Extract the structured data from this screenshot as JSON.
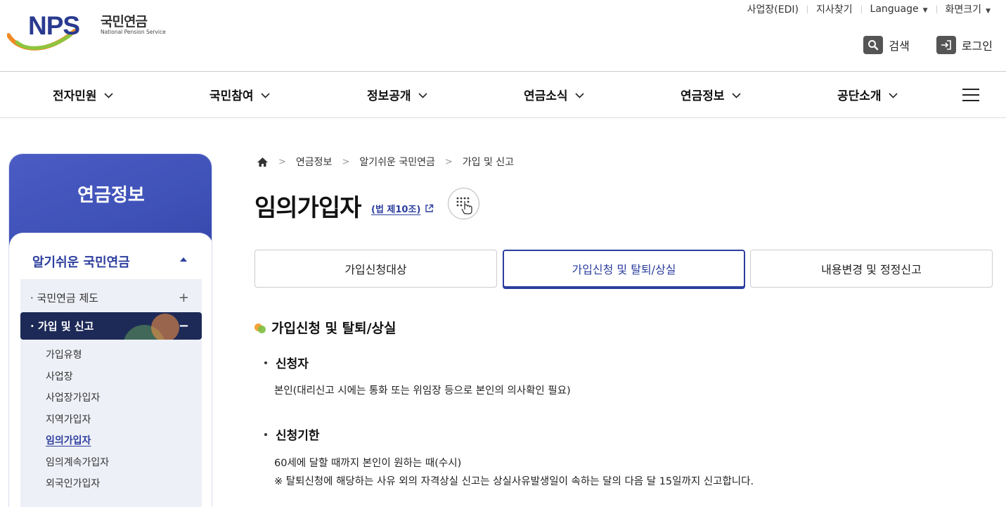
{
  "header": {
    "logo_mark": "NPS",
    "logo_name_ko": "국민연금",
    "logo_name_en": "National Pension Service",
    "util": {
      "edi": "사업장(EDI)",
      "branch": "지사찾기",
      "language": "Language",
      "screen_size": "화면크기"
    },
    "search_label": "검색",
    "login_label": "로그인"
  },
  "gnb": [
    "전자민원",
    "국민참여",
    "정보공개",
    "연금소식",
    "연금정보",
    "공단소개"
  ],
  "sidebar": {
    "title": "연금정보",
    "section": "알기쉬운 국민연금",
    "items": [
      {
        "label": "· 국민연금 제도",
        "toggle": "+"
      },
      {
        "label": "· 가입 및 신고",
        "toggle": "−"
      }
    ],
    "subitems": [
      "가입유형",
      "사업장",
      "사업장가입자",
      "지역가입자",
      "임의가입자",
      "임의계속가입자",
      "외국인가입자"
    ]
  },
  "breadcrumb": [
    "연금정보",
    "알기쉬운 국민연금",
    "가입 및 신고"
  ],
  "page": {
    "title": "임의가입자",
    "law_link": "(법 제10조)"
  },
  "tabs": [
    "가입신청대상",
    "가입신청 및 탈퇴/상실",
    "내용변경 및 정정신고"
  ],
  "content": {
    "heading": "가입신청 및 탈퇴/상실",
    "applicant_title": "신청자",
    "applicant_text": "본인(대리신고 시에는 통화 또는 위임장 등으로 본인의 의사확인 필요)",
    "deadline_title": "신청기한",
    "deadline_text1": "60세에 달할 때까지 본인이 원하는 때(수시)",
    "deadline_text2": "※ 탈퇴신청에 해당하는 사유 외의 자격상실 신고는 상실사유발생일이 속하는 달의 다음 달 15일까지 신고합니다."
  },
  "colors": {
    "brand_navy": "#2c3e9e",
    "sidebar_blue": "#4152bc",
    "active_item": "#1d2a57"
  }
}
